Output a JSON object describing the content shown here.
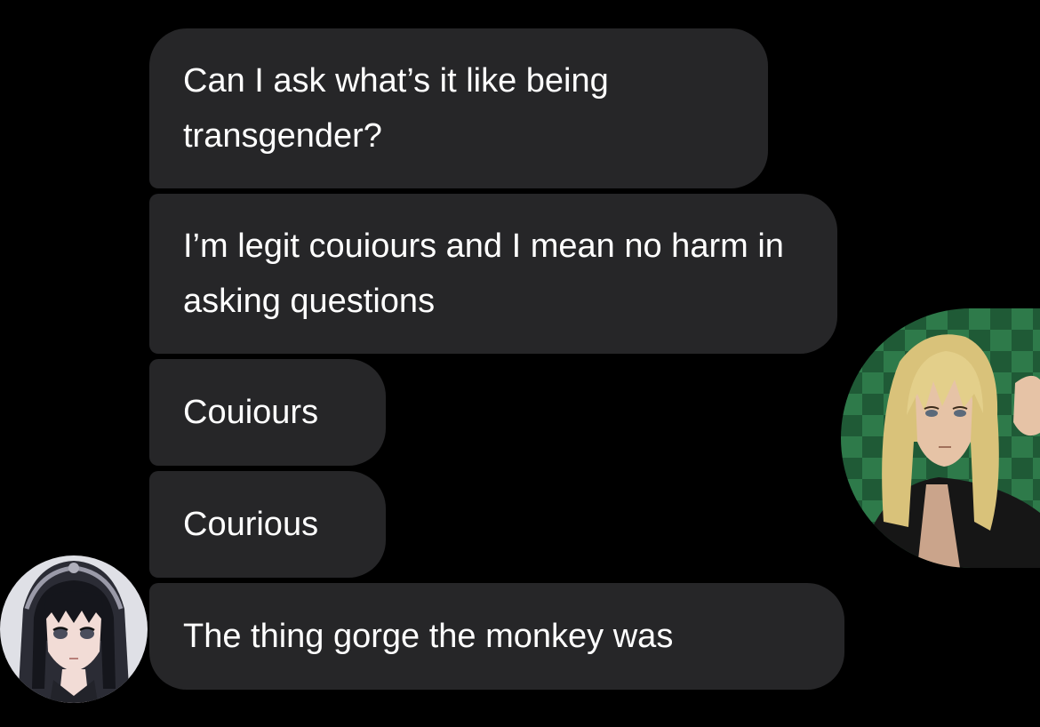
{
  "messages": [
    {
      "text": "Can I ask what’s it like being transgender?"
    },
    {
      "text": "I’m legit couiours and I mean no harm in asking questions"
    },
    {
      "text": "Couiours"
    },
    {
      "text": "Courious"
    },
    {
      "text": "The thing gorge the monkey was"
    }
  ],
  "avatars": {
    "left": {
      "icon": "anime-girl-avatar"
    },
    "right": {
      "icon": "anime-blonde-man-avatar"
    }
  },
  "colors": {
    "background": "#000000",
    "bubble": "#262628",
    "text": "#ffffff"
  }
}
